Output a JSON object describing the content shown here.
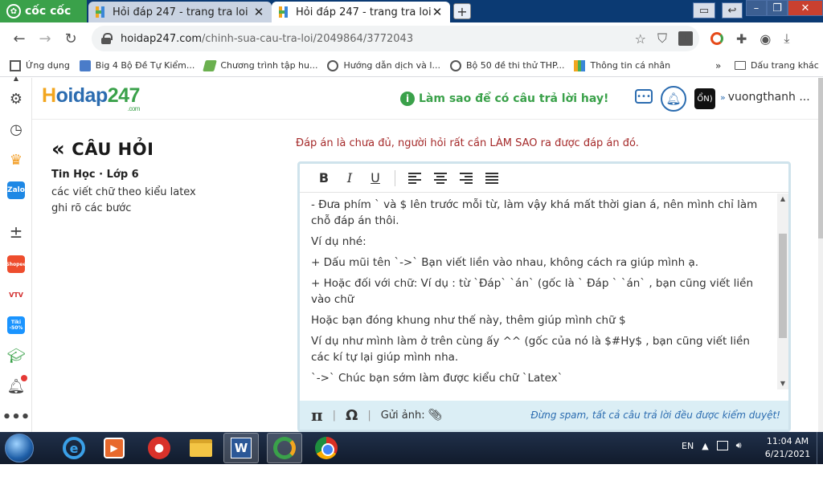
{
  "browser": {
    "brand": "cốc cốc",
    "tabs": [
      {
        "title": "Hỏi đáp 247 - trang tra loi"
      },
      {
        "title": "Hỏi đáp 247 - trang tra loi"
      }
    ],
    "url_host": "hoidap247.com",
    "url_path": "/chinh-sua-cau-tra-loi/2049864/3772043",
    "bookmarks": [
      "Ứng dụng",
      "Big 4 Bộ Đề Tự Kiểm...",
      "Chương trình tập hu...",
      "Hướng dẫn dịch và l...",
      "Bộ 50 đề thi thử THP...",
      "Thông tin cá nhân"
    ],
    "bookmarks_more": "»",
    "bookmarks_folder": "Dấu trang khác"
  },
  "sidebar": {
    "icons": [
      "gear-icon",
      "history-icon",
      "crown-icon",
      "zalo-icon",
      "divider-icon",
      "shopee-icon",
      "vtv-icon",
      "tiki-icon",
      "graduation-icon",
      "bell-icon",
      "more-icon"
    ],
    "zalo": "Zalo",
    "shopee": "Shopee",
    "vtv": "VTV",
    "tiki": "Tiki -50%"
  },
  "site": {
    "logo_h": "H",
    "logo_rest": "oidap",
    "logo_num": "247",
    "logo_com": ".com",
    "tip": "Làm sao để có câu trả lời hay!",
    "avatar": "ỔN)",
    "username": "vuongthanh ..."
  },
  "question": {
    "back_label": "CÂU HỎI",
    "meta": "Tin Học · Lớp 6",
    "line1": "các viết chữ theo kiểu latex",
    "line2": "ghi rõ các bước"
  },
  "notice": "Đáp án là chưa đủ, người hỏi rất cần LÀM SAO ra được đáp án đó.",
  "editor": {
    "toolbar": {
      "bold": "B",
      "italic": "I",
      "underline": "U"
    },
    "paragraphs": [
      "-  Đưa phím ` và $ lên trước mỗi từ, làm vậy khá mất thời gian á, nên mình chỉ làm chỗ đáp án thôi.",
      "Ví dụ nhé:",
      "+ Dấu mũi tên `->`  Bạn viết liền vào nhau, không cách ra giúp mình ạ.",
      "+ Hoặc đối với chữ: Ví dụ : từ `Đáp` `án` (gốc là ` Đáp `  `án` , bạn cũng viết liền vào chữ",
      "Hoặc bạn đóng khung như thế này, thêm giúp mình chữ $",
      "Ví dụ như mình làm ở trên cùng ấy ^^ (gốc của nó là $#Hy$ , bạn cũng viết liền các kí tự lại giúp mình nha.",
      "`->` Chúc bạn sớm làm được kiểu chữ `Latex`"
    ],
    "footer": {
      "pi": "π",
      "omega": "Ω",
      "upload_label": "Gửi ảnh:",
      "warning": "Đừng spam, tất cả câu trả lời đều được kiểm duyệt!"
    }
  },
  "taskbar": {
    "lang": "EN",
    "time": "11:04 AM",
    "date": "6/21/2021",
    "word": "W"
  }
}
